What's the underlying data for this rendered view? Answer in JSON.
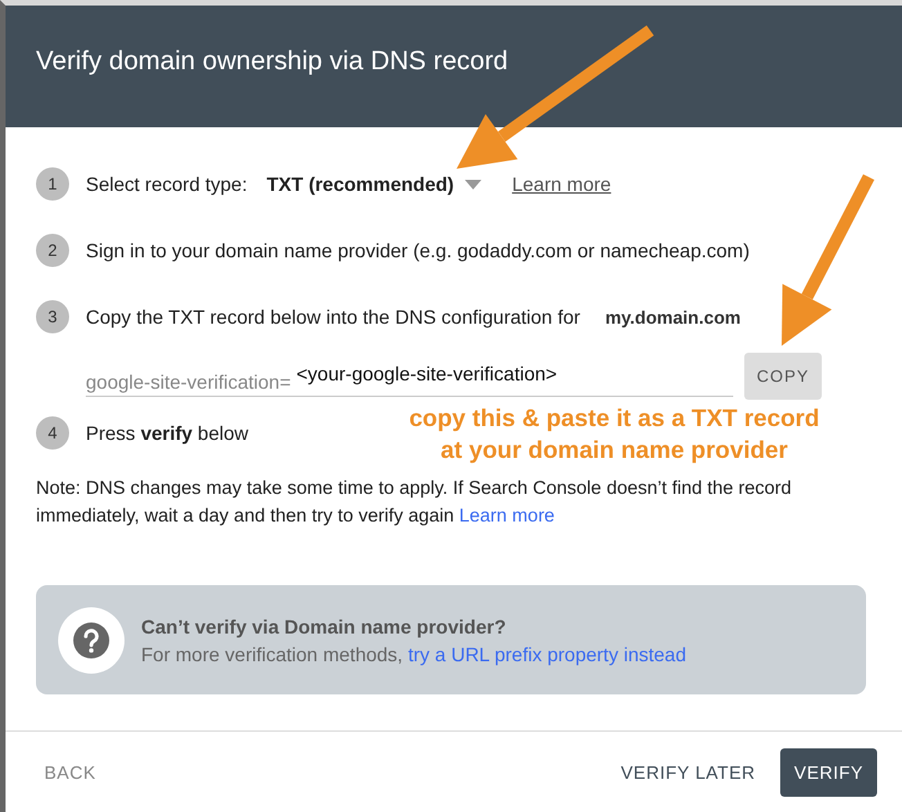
{
  "dialog": {
    "title": "Verify domain ownership via DNS record"
  },
  "steps": [
    {
      "number": "1",
      "kind": "select",
      "label": "Select record type:",
      "value": "TXT (recommended)",
      "link": "Learn more"
    },
    {
      "number": "2",
      "kind": "text",
      "label": "Sign in to your domain name provider (e.g. godaddy.com or namecheap.com)"
    },
    {
      "number": "3",
      "kind": "domain",
      "label": "Copy the TXT record below into the DNS configuration for",
      "domain": "my.domain.com",
      "record": {
        "prefix": "google-site-verification=",
        "value": "<your-google-site-verification>",
        "button": "COPY"
      }
    },
    {
      "number": "4",
      "kind": "text",
      "label": "Press **verify** below"
    }
  ],
  "annotation": {
    "lines": [
      "copy this & paste it as a TXT record",
      "at your domain name provider"
    ]
  },
  "note": {
    "text": "Note: DNS changes may take some time to apply. If Search Console doesn’t find the record immediately, wait a day and then try to verify again",
    "link": "Learn more"
  },
  "help": {
    "title": "Can’t verify via Domain name provider?",
    "text": "For more verification methods,",
    "link": "try a URL prefix property instead"
  },
  "footer": {
    "back": "BACK",
    "buttons": [
      {
        "label": "VERIFY LATER",
        "kind": "text"
      },
      {
        "label": "VERIFY",
        "kind": "filled"
      }
    ]
  }
}
